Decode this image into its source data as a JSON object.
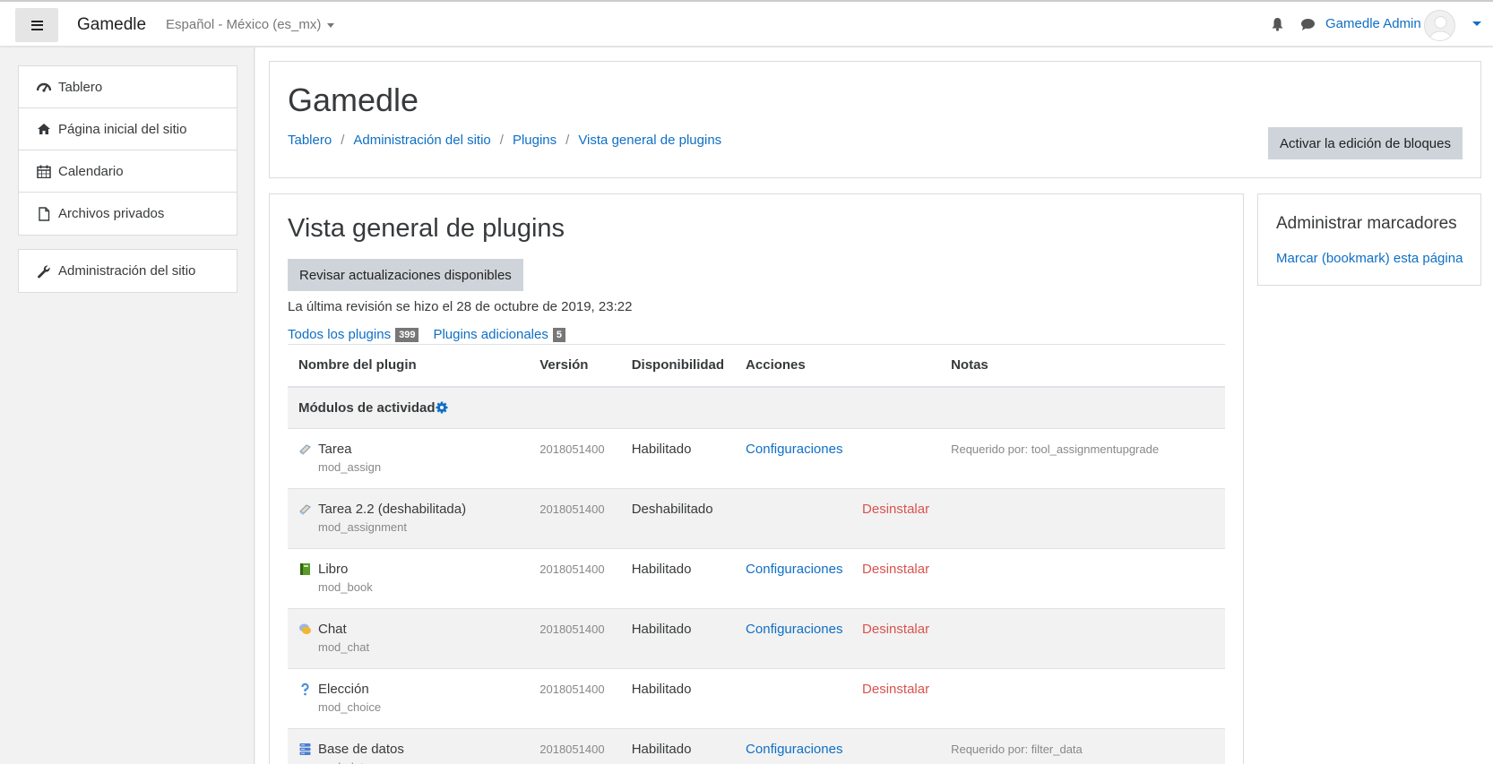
{
  "navbar": {
    "brand": "Gamedle",
    "language": "Español - México (es_mx)",
    "user_name": "Gamedle Admin"
  },
  "drawer": {
    "items": [
      {
        "label": "Tablero",
        "icon": "dashboard-icon"
      },
      {
        "label": "Página inicial del sitio",
        "icon": "home-icon"
      },
      {
        "label": "Calendario",
        "icon": "calendar-icon"
      },
      {
        "label": "Archivos privados",
        "icon": "file-icon"
      }
    ],
    "admin": {
      "label": "Administración del sitio",
      "icon": "wrench-icon"
    }
  },
  "header": {
    "title": "Gamedle",
    "breadcrumb": [
      "Tablero",
      "Administración del sitio",
      "Plugins",
      "Vista general de plugins"
    ],
    "edit_button": "Activar la edición de bloques"
  },
  "main": {
    "title": "Vista general de plugins",
    "check_button": "Revisar actualizaciones disponibles",
    "last_check": "La última revisión se hizo el 28 de octubre de 2019, 23:22",
    "filters": [
      {
        "label": "Todos los plugins",
        "count": "399"
      },
      {
        "label": "Plugins adicionales",
        "count": "5"
      }
    ],
    "columns": [
      "Nombre del plugin",
      "Versión",
      "Disponibilidad",
      "Acciones",
      "Notas"
    ],
    "category": "Módulos de actividad",
    "rows": [
      {
        "name": "Tarea",
        "component": "mod_assign",
        "version": "2018051400",
        "availability": "Habilitado",
        "settings": "Configuraciones",
        "uninstall": "",
        "notes": "Requerido por: tool_assignmentupgrade",
        "icon": "assign-icon"
      },
      {
        "name": "Tarea 2.2 (deshabilitada)",
        "component": "mod_assignment",
        "version": "2018051400",
        "availability": "Deshabilitado",
        "settings": "",
        "uninstall": "Desinstalar",
        "notes": "",
        "icon": "assign-icon"
      },
      {
        "name": "Libro",
        "component": "mod_book",
        "version": "2018051400",
        "availability": "Habilitado",
        "settings": "Configuraciones",
        "uninstall": "Desinstalar",
        "notes": "",
        "icon": "book-icon"
      },
      {
        "name": "Chat",
        "component": "mod_chat",
        "version": "2018051400",
        "availability": "Habilitado",
        "settings": "Configuraciones",
        "uninstall": "Desinstalar",
        "notes": "",
        "icon": "chat-bubble-icon"
      },
      {
        "name": "Elección",
        "component": "mod_choice",
        "version": "2018051400",
        "availability": "Habilitado",
        "settings": "",
        "uninstall": "Desinstalar",
        "notes": "",
        "icon": "question-icon"
      },
      {
        "name": "Base de datos",
        "component": "mod_data",
        "version": "2018051400",
        "availability": "Habilitado",
        "settings": "Configuraciones",
        "uninstall": "",
        "notes": "Requerido por: filter_data",
        "icon": "database-icon"
      }
    ]
  },
  "bookmarks": {
    "title": "Administrar marcadores",
    "link": "Marcar (bookmark) esta página"
  }
}
